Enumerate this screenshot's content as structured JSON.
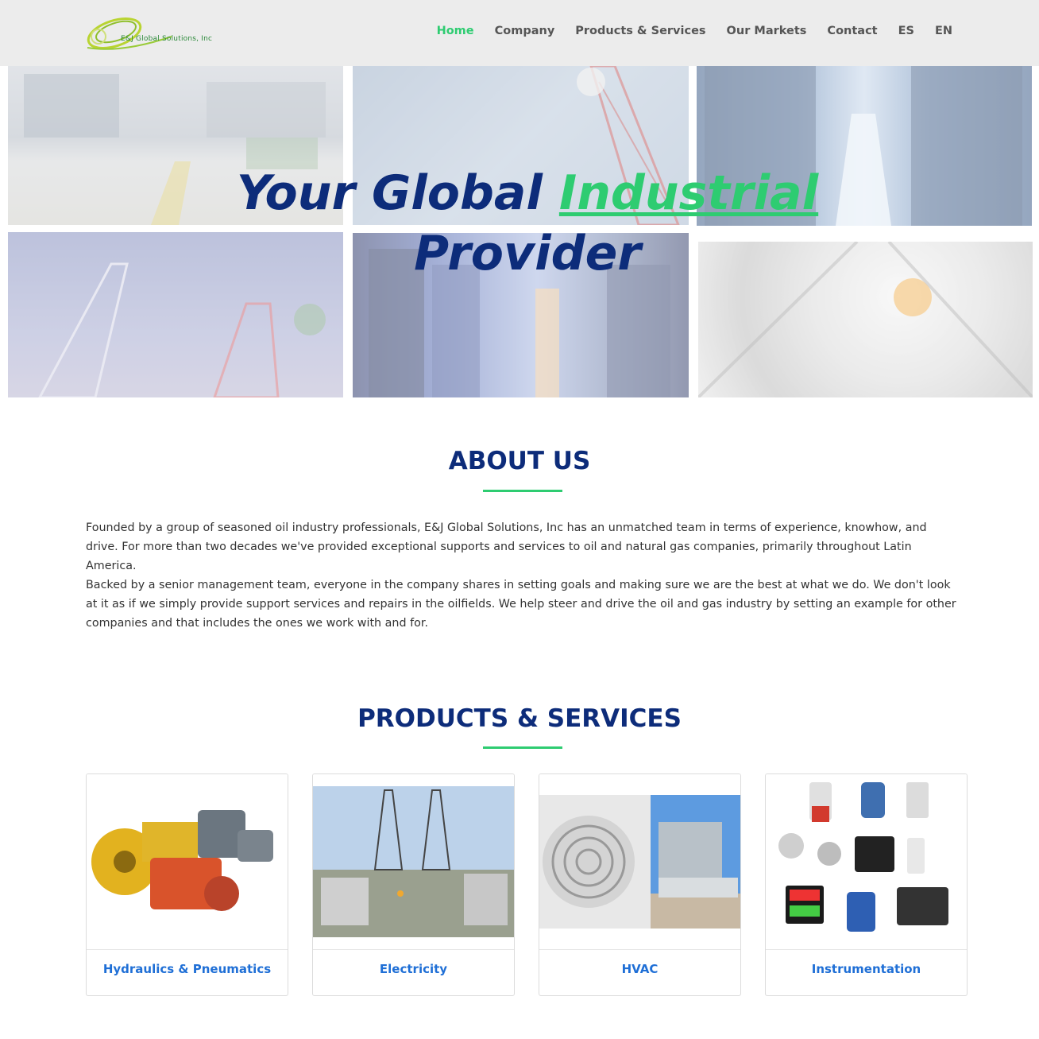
{
  "brand": {
    "logo_text": "E&J Global Solutions, Inc",
    "logo_icon": "swoosh-logo-icon",
    "colors": {
      "primary": "#0d2c7a",
      "accent": "#2ecc71",
      "link": "#1f6fd6",
      "nav_bg": "#ececec"
    }
  },
  "nav": {
    "items": [
      {
        "label": "Home",
        "active": true
      },
      {
        "label": "Company",
        "active": false
      },
      {
        "label": "Products & Services",
        "active": false
      },
      {
        "label": "Our Markets",
        "active": false
      },
      {
        "label": "Contact",
        "active": false
      },
      {
        "label": "ES",
        "active": false
      },
      {
        "label": "EN",
        "active": false
      }
    ]
  },
  "hero": {
    "title_part1": "Your Global ",
    "title_accent": "Industrial",
    "title_part2": "Provider",
    "tiles": [
      "warehouse-photo",
      "antenna-tower-photo",
      "server-aisle-photo",
      "telecom-towers-photo",
      "data-center-photo",
      "tower-climber-photo"
    ]
  },
  "about": {
    "title": "ABOUT US",
    "paragraph1": "Founded by a group of seasoned oil industry professionals, E&J Global Solutions, Inc has an unmatched team in terms of experience, knowhow, and drive. For more than two decades we've provided exceptional supports and services to oil and natural gas companies, primarily throughout Latin America.",
    "paragraph2": "Backed by a senior management team, everyone in the company shares in setting goals and making sure we are the best at what we do. We don't look at it as if we simply provide support services and repairs in the oilfields. We help steer and drive the oil and gas industry by setting an example for other companies and that includes the ones we work with and for."
  },
  "products": {
    "title": "PRODUCTS & SERVICES",
    "cards": [
      {
        "label": "Hydraulics & Pneumatics",
        "image": "hydraulic-pumps-photo"
      },
      {
        "label": "Electricity",
        "image": "electrical-substation-photo"
      },
      {
        "label": "HVAC",
        "image": "air-conditioner-unit-photo"
      },
      {
        "label": "Instrumentation",
        "image": "instruments-collection-photo"
      }
    ]
  }
}
